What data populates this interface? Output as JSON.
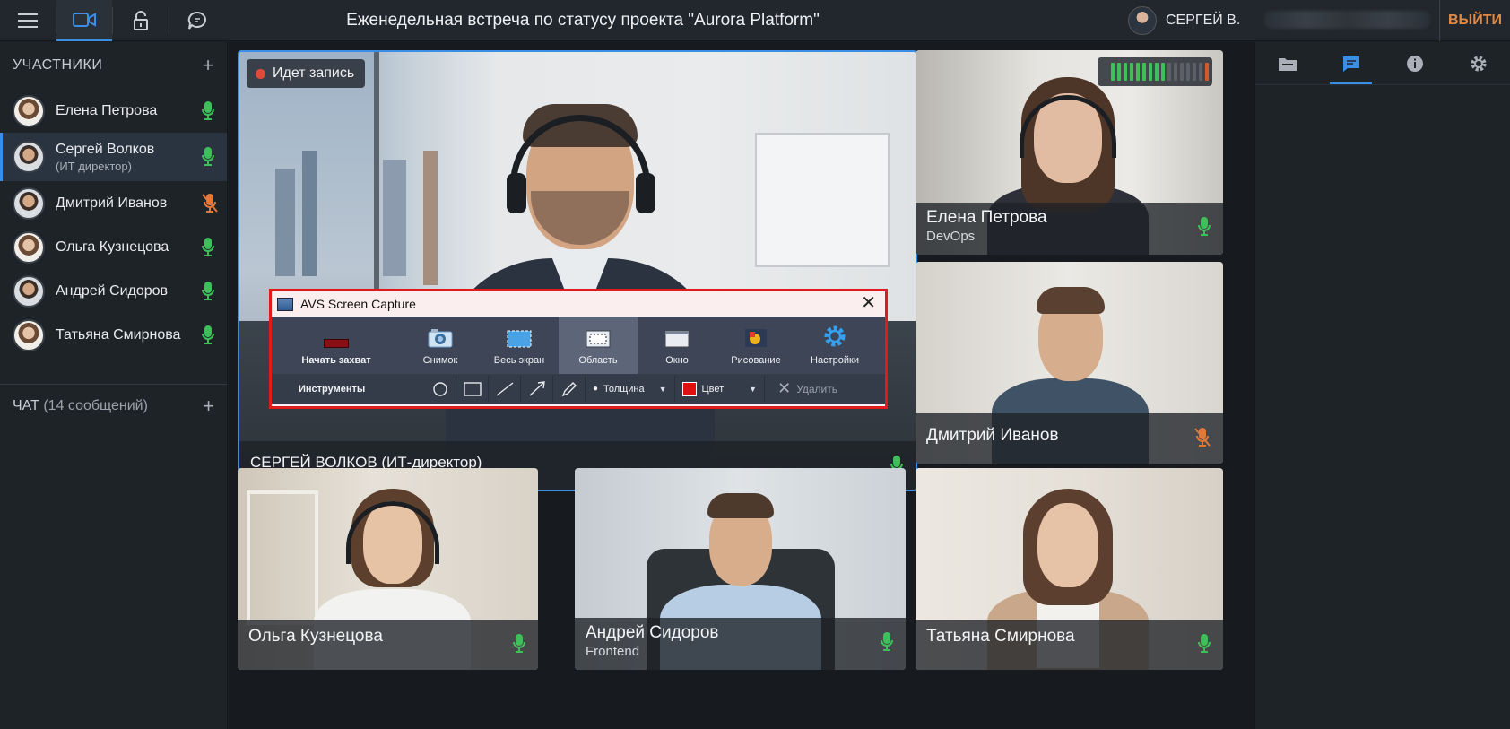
{
  "topbar": {
    "title": "Еженедельная встреча по статусу проекта \"Aurora Platform\"",
    "user_name": "СЕРГЕЙ В.",
    "exit_label": "ВЫЙТИ",
    "icons": [
      "menu-icon",
      "video-camera-icon",
      "lock-icon",
      "chat-bubble-icon"
    ]
  },
  "sidebar": {
    "participants_header": "УЧАСТНИКИ",
    "participants": [
      {
        "name": "Елена Петрова",
        "role": "",
        "mic": "on"
      },
      {
        "name": "Сергей Волков",
        "role": "(ИТ директор)",
        "mic": "on",
        "active": true
      },
      {
        "name": "Дмитрий Иванов",
        "role": "",
        "mic": "muted"
      },
      {
        "name": "Ольга Кузнецова",
        "role": "",
        "mic": "on"
      },
      {
        "name": "Андрей Сидоров",
        "role": "",
        "mic": "on"
      },
      {
        "name": "Татьяна Смирнова",
        "role": "",
        "mic": "on"
      }
    ],
    "chat_label": "ЧАТ",
    "chat_count": "(14 сообщений)"
  },
  "right_panel": {
    "tabs": [
      "folder-icon",
      "chat-icon",
      "info-icon",
      "settings-icon"
    ],
    "active_tab": "chat-icon"
  },
  "video": {
    "recording_label": "Идет запись",
    "main": {
      "name": "СЕРГЕЙ ВОЛКОВ (ИТ-директор)",
      "mic": "on"
    },
    "tiles": [
      {
        "name": "Елена Петрова",
        "role": "DevOps",
        "mic": "on"
      },
      {
        "name": "Дмитрий Иванов",
        "role": "",
        "mic": "muted"
      },
      {
        "name": "Ольга Кузнецова",
        "role": "",
        "mic": "on"
      },
      {
        "name": "Андрей Сидоров",
        "role": "Frontend",
        "mic": "on"
      },
      {
        "name": "Татьяна Смирнова",
        "role": "",
        "mic": "on"
      }
    ],
    "volume_level": 0.55
  },
  "avs": {
    "title": "AVS Screen Capture",
    "tools": [
      "Начать захват",
      "Снимок",
      "Весь экран",
      "Область",
      "Окно",
      "Рисование",
      "Настройки"
    ],
    "active_tool": "Область",
    "instruments_label": "Инструменты",
    "thickness_label": "Толщина",
    "color_label": "Цвет",
    "delete_label": "Удалить"
  },
  "colors": {
    "accent": "#3a8ee6",
    "mic_on": "#3fbf5a",
    "mic_muted": "#e0793a",
    "exit": "#e08a45",
    "recording": "#e04a3a",
    "avs_border": "#e01b1b"
  }
}
